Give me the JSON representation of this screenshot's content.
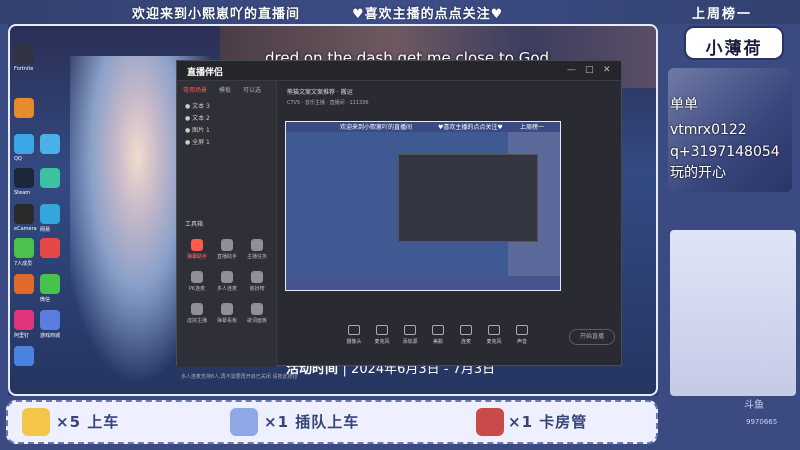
{
  "overlay": {
    "welcome": "欢迎来到小熙崽吖的直播间",
    "follow": "♥喜欢主播的点点关注♥",
    "rank_title": "上周榜一",
    "rank_name": "小薄荷"
  },
  "stream": {
    "lyric": "dred on the dash get me close to God",
    "activity_label": "活动时间",
    "activity_dates": "| 2024年6月3日 - 7月3日"
  },
  "desktop_icons": [
    "Fortnite",
    "QQ",
    "QQ飞车",
    "Steam",
    "eCamera",
    "网易",
    "7人成员",
    "微信",
    "阿里钉",
    "游戏商城"
  ],
  "obs_window": {
    "logo": "直播伴侣",
    "tabs": [
      "常用场景",
      "模板",
      "可以选"
    ],
    "sources": [
      "● 文本 3",
      "● 文本 2",
      "● 图片 1",
      "● 全屏 1"
    ],
    "tools_label": "工具箱",
    "tools": [
      "弹幕助手",
      "直播助手",
      "主播任务",
      "PK连麦",
      "多人连麦",
      "装扮榜",
      "虚拟主播",
      "弹幕看板",
      "歌词面板"
    ],
    "tip": "多人连麦支持6人,再不需要再开启已关闭 请按此按钮",
    "room_title": "熊猫文案文案推荐 · 搬运",
    "room_info": "CTV5 · 音乐主播 · 直播间 · 111336",
    "preview_welcome": "欢迎来到小熙崽吖的直播间",
    "preview_follow": "♥喜欢主播的点点关注♥",
    "preview_rank": "上周榜一",
    "controls": [
      "摄像头",
      "麦克风",
      "添加源",
      "美颜",
      "连麦",
      "麦克风",
      "声音"
    ],
    "start_label": "开始直播"
  },
  "right_panel": {
    "contact_line1": "单单",
    "contact_line2": "vtmrx0122",
    "contact_line3": "q+3197148054",
    "contact_line4": "玩的开心",
    "watermark_brand": "斗鱼",
    "watermark_id": "9970665"
  },
  "gifts": [
    {
      "label": "×5  上车",
      "color": "#f3c64a"
    },
    {
      "label": "×1  插队上车",
      "color": "#8fa9e6"
    },
    {
      "label": "×1  卡房管",
      "color": "#c84a4a"
    }
  ]
}
